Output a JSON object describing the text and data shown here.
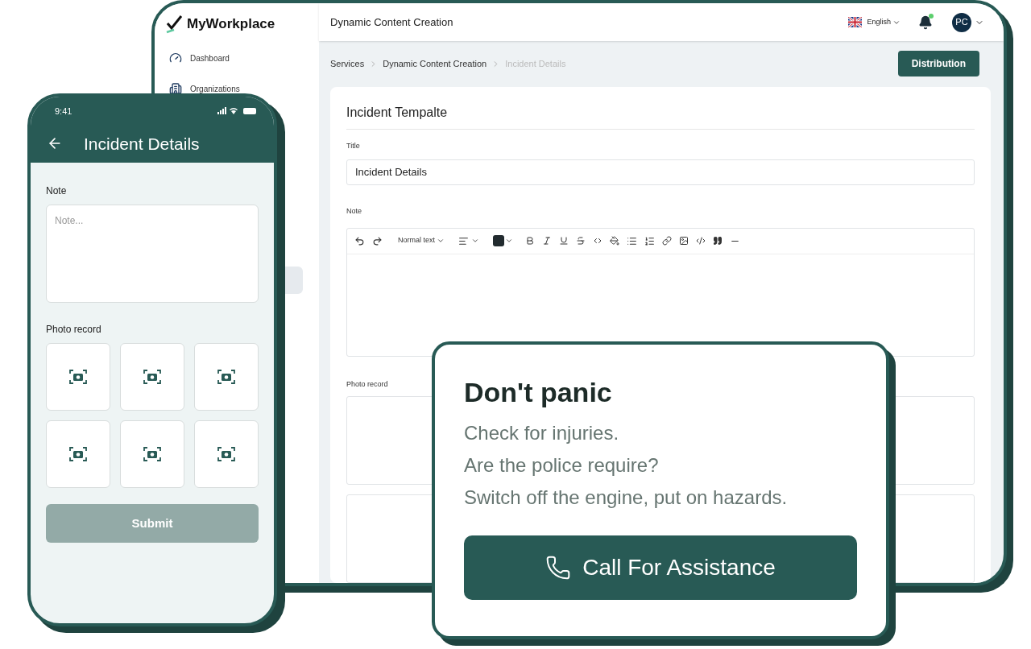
{
  "desktop": {
    "logo": "MyWorkplace",
    "page_title": "Dynamic Content Creation",
    "language": "English",
    "avatar_initials": "PC",
    "sidebar": {
      "items": [
        {
          "label": "Dashboard",
          "kind": "dashboard"
        },
        {
          "label": "Organizations",
          "kind": "building"
        }
      ]
    },
    "breadcrumbs": [
      {
        "label": "Services",
        "selected": false
      },
      {
        "label": "Dynamic Content Creation",
        "selected": false
      },
      {
        "label": "Incident Details",
        "selected": true
      }
    ],
    "distribution_button": "Distribution",
    "form": {
      "heading": "Incident Tempalte",
      "title_label": "Title",
      "title_value": "Incident Details",
      "note_label": "Note",
      "text_style": "Normal text",
      "photo_label": "Photo record"
    }
  },
  "phone": {
    "time": "9:41",
    "title": "Incident Details",
    "note_label": "Note",
    "note_placeholder": "Note...",
    "photo_label": "Photo record",
    "submit": {
      "label": "Submit",
      "disabled": true
    }
  },
  "card": {
    "heading": "Don't panic",
    "lines": [
      "Check for injuries.",
      "Are the police require?",
      "Switch off the engine, put on hazards."
    ],
    "button": "Call For Assistance"
  }
}
